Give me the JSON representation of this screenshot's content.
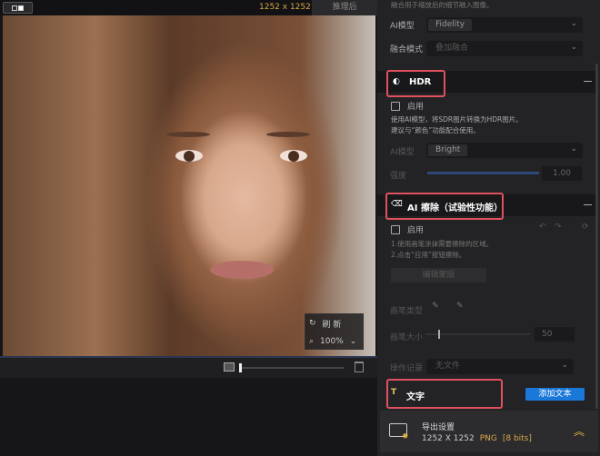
{
  "viewer": {
    "dimensions": "1252 x 1252",
    "after_tab": "推理后",
    "refresh_label": "刷 新",
    "zoom": "100%",
    "slider_position": 0
  },
  "panel": {
    "top_note": "融合用于缩放后的细节融入图像。",
    "model_label": "AI模型",
    "model_value": "Fidelity",
    "blend_label": "融合模式",
    "blend_value": "叠加融合",
    "hdr": {
      "title": "HDR",
      "enable": "启用",
      "desc1": "使用AI模型，将SDR图片转换为HDR图片。",
      "desc2": "建议与“颜色”功能配合使用。",
      "model_label": "AI模型",
      "model_value": "Bright",
      "strength_label": "强度",
      "strength_value": "1.00"
    },
    "erase": {
      "title": "AI 擦除（试验性功能）",
      "enable": "启用",
      "desc1": "1.使用画笔涂抹需要擦除的区域。",
      "desc2": "2.点击“应用”按钮擦除。",
      "edit_button": "编辑蒙版",
      "brush_type_label": "画笔类型",
      "brush_size_label": "画笔大小",
      "brush_size": "50",
      "history_label": "操作记录",
      "history_value": "无文件"
    },
    "text": {
      "title": "文字",
      "add_button": "添加文本"
    },
    "export": {
      "title": "导出设置",
      "size": "1252 X 1252",
      "format": "PNG",
      "bits": "[8 bits]"
    }
  },
  "colors": {
    "accent": "#1a78d8",
    "highlight": "#e0505e",
    "gold": "#d9a74a"
  }
}
